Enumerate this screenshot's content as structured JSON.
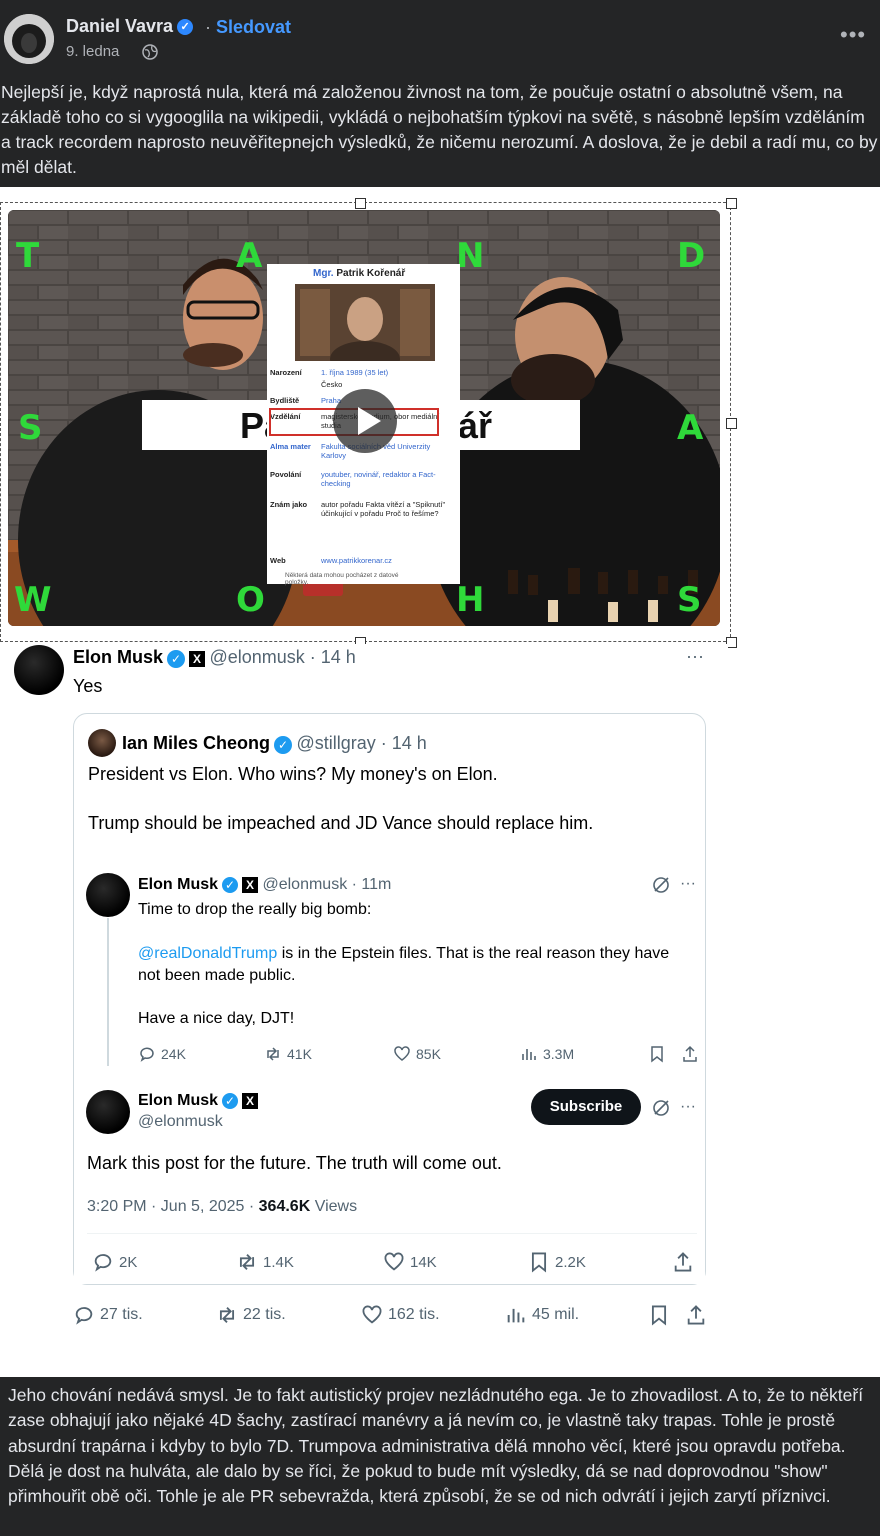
{
  "top_post": {
    "author": "Daniel Vavra",
    "follow_label": "Sledovat",
    "separator": "·",
    "date": "9. ledna",
    "text": "Nejlepší je, když naprostá nula, která má založenou živnost na tom, že poučuje ostatní o absolutně všem, na základě toho co si vygooglila na wikipedii, vykládá o nejbohatším týpkovi na světě, s násobně lepším vzděláním a track recordem naprosto neuvěřitepnejch výsledků, že ničemu nerozumí. A doslova, že je debil a radí mu, co by měl dělat."
  },
  "video": {
    "letters": [
      "T",
      "A",
      "N",
      "D",
      "S",
      "A",
      "W",
      "O",
      "H",
      "S"
    ],
    "banner_left": "Pa",
    "banner_right": "ář",
    "wiki": {
      "title_prefix": "Mgr.",
      "title_name": "Patrik Kořenář",
      "rows": [
        {
          "label": "Narození",
          "value": "1. října 1989 (35 let)"
        },
        {
          "label": "",
          "value": "Česko"
        },
        {
          "label": "Bydliště",
          "value": "Praha"
        },
        {
          "label": "Vzdělání",
          "value": "magisterské studium, obor mediální studia"
        },
        {
          "label": "Alma mater",
          "value": "Fakulta sociálních věd Univerzity Karlovy"
        },
        {
          "label": "Povolání",
          "value": "youtuber, novinář, redaktor a Fact-checking"
        },
        {
          "label": "Znám jako",
          "value": "autor pořadu Fakta vítězí a \"Spiknutí\" účinkující v pořadu Proč to řešíme?"
        },
        {
          "label": "Web",
          "value": "www.patrikkorenar.cz"
        }
      ],
      "footnote": "Některá data mohou pocházet z datové položky."
    }
  },
  "tweet": {
    "name": "Elon Musk",
    "handle": "@elonmusk · 14 h",
    "text": "Yes",
    "more": "···",
    "quote": {
      "name": "Ian Miles Cheong",
      "handle": "@stillgray · 14 h",
      "line1": "President vs Elon. Who wins? My money's on Elon.",
      "line2": "Trump should be impeached and JD Vance should replace him."
    },
    "inner1": {
      "name": "Elon Musk",
      "handle": "@elonmusk · 11m",
      "line1": "Time to drop the really big bomb:",
      "mention": "@realDonaldTrump",
      "line2_rest": " is in the Epstein files. That is the real reason they have",
      "line3": "not been made public.",
      "line4": "Have a nice day, DJT!",
      "stats": {
        "replies": "24K",
        "reposts": "41K",
        "likes": "85K",
        "views": "3.3M"
      }
    },
    "inner2": {
      "name": "Elon Musk",
      "handle": "@elonmusk",
      "subscribe_label": "Subscribe",
      "text": "Mark this post for the future. The truth will come out.",
      "timestamp": "3:20 PM · Jun 5, 2025 · ",
      "views_count": "364.6K",
      "views_label": " Views",
      "stats": {
        "replies": "2K",
        "reposts": "1.4K",
        "likes": "14K",
        "bookmarks": "2.2K"
      }
    },
    "outer_stats": {
      "replies": "27 tis.",
      "reposts": "22 tis.",
      "likes": "162 tis.",
      "views": "45 mil."
    }
  },
  "bottom_post": {
    "text": "Jeho chování nedává smysl. Je to fakt autistický projev nezládnutého ega. Je to zhovadilost. A to, že to někteří zase obhajují jako nějaké 4D šachy, zastírací manévry a já nevím co, je vlastně taky trapas. Tohle je prostě absurdní trapárna i kdyby to bylo 7D. Trumpova administrativa dělá mnoho věcí, které jsou opravdu potřeba. Dělá je dost na hulváta, ale dalo by se říci, že pokud to bude mít výsledky, dá se nad doprovodnou \"show\" přimhouřit obě oči. Tohle je ale PR sebevražda, která způsobí, že se od nich odvrátí i jejich zarytí příznivci."
  }
}
